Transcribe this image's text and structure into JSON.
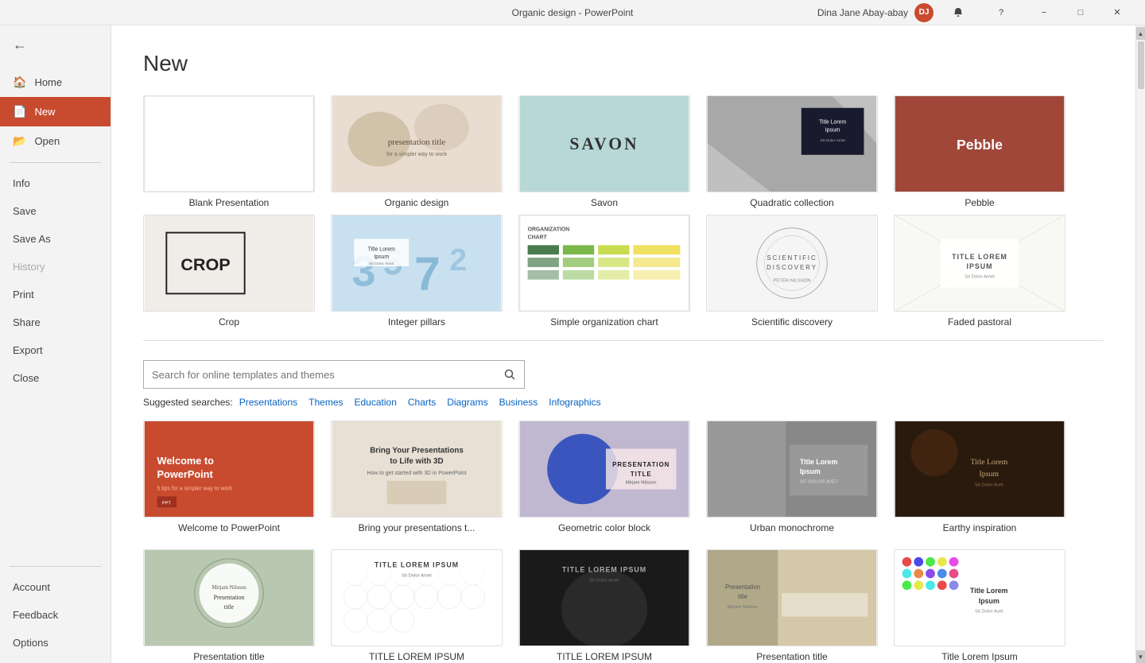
{
  "titlebar": {
    "title": "Organic design - PowerPoint",
    "user": "Dina Jane Abay-abay",
    "avatar_initials": "DJ"
  },
  "sidebar": {
    "back_label": "",
    "items": [
      {
        "id": "home",
        "label": "Home",
        "icon": "🏠",
        "active": false
      },
      {
        "id": "new",
        "label": "New",
        "icon": "📄",
        "active": true
      },
      {
        "id": "open",
        "label": "Open",
        "icon": "📂",
        "active": false
      }
    ],
    "secondary_items": [
      {
        "id": "info",
        "label": "Info",
        "dimmed": false
      },
      {
        "id": "save",
        "label": "Save",
        "dimmed": false
      },
      {
        "id": "save-as",
        "label": "Save As",
        "dimmed": false
      },
      {
        "id": "history",
        "label": "History",
        "dimmed": true
      },
      {
        "id": "print",
        "label": "Print",
        "dimmed": false
      },
      {
        "id": "share",
        "label": "Share",
        "dimmed": false
      },
      {
        "id": "export",
        "label": "Export",
        "dimmed": false
      },
      {
        "id": "close",
        "label": "Close",
        "dimmed": false
      }
    ],
    "bottom_items": [
      {
        "id": "account",
        "label": "Account"
      },
      {
        "id": "feedback",
        "label": "Feedback"
      },
      {
        "id": "options",
        "label": "Options"
      }
    ]
  },
  "main": {
    "page_title": "New",
    "templates_row1": [
      {
        "id": "blank",
        "label": "Blank Presentation",
        "type": "blank"
      },
      {
        "id": "organic",
        "label": "Organic design",
        "type": "organic"
      },
      {
        "id": "savon",
        "label": "Savon",
        "type": "savon"
      },
      {
        "id": "quadratic",
        "label": "Quadratic collection",
        "type": "quadratic"
      },
      {
        "id": "pebble",
        "label": "Pebble",
        "type": "pebble"
      }
    ],
    "templates_row2": [
      {
        "id": "crop",
        "label": "Crop",
        "type": "crop"
      },
      {
        "id": "integer",
        "label": "Integer pillars",
        "type": "integer"
      },
      {
        "id": "org-chart",
        "label": "Simple organization chart",
        "type": "org"
      },
      {
        "id": "scientific",
        "label": "Scientific discovery",
        "type": "scientific"
      },
      {
        "id": "faded",
        "label": "Faded pastoral",
        "type": "faded"
      }
    ],
    "search": {
      "placeholder": "Search for online templates and themes",
      "button_label": "🔍"
    },
    "suggested": {
      "label": "Suggested searches:",
      "items": [
        "Presentations",
        "Themes",
        "Education",
        "Charts",
        "Diagrams",
        "Business",
        "Infographics"
      ]
    },
    "online_templates_row1": [
      {
        "id": "welcome-ppt",
        "label": "Welcome to PowerPoint",
        "type": "welcome"
      },
      {
        "id": "bring-3d",
        "label": "Bring your presentations t...",
        "type": "bring"
      },
      {
        "id": "geometric",
        "label": "Geometric color block",
        "type": "geometric"
      },
      {
        "id": "urban",
        "label": "Urban monochrome",
        "type": "urban"
      },
      {
        "id": "earthy",
        "label": "Earthy inspiration",
        "type": "earthy"
      }
    ],
    "online_templates_row2": [
      {
        "id": "floral",
        "label": "Presentation title",
        "type": "floral"
      },
      {
        "id": "white-texture",
        "label": "TITLE LOREM IPSUM",
        "type": "white-texture"
      },
      {
        "id": "dark-dog",
        "label": "TITLE LOREM IPSUM",
        "type": "dark-dog"
      },
      {
        "id": "pres-title2",
        "label": "Presentation title",
        "type": "pres-title2"
      },
      {
        "id": "colorful",
        "label": "Title Lorem Ipsum",
        "type": "colorful"
      }
    ]
  },
  "colors": {
    "accent": "#c84b2f",
    "sidebar_active_bg": "#c84b2f",
    "link_color": "#0563c1"
  }
}
